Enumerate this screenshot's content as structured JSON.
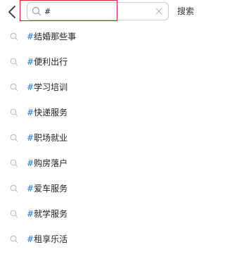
{
  "header": {
    "search": {
      "value": "#",
      "placeholder": ""
    },
    "submit_label": "搜索"
  },
  "suggestions": [
    {
      "hash": "#",
      "text": "结婚那些事"
    },
    {
      "hash": "#",
      "text": "便利出行"
    },
    {
      "hash": "#",
      "text": "学习培训"
    },
    {
      "hash": "#",
      "text": "快递服务"
    },
    {
      "hash": "#",
      "text": "职场就业"
    },
    {
      "hash": "#",
      "text": "购房落户"
    },
    {
      "hash": "#",
      "text": "爱车服务"
    },
    {
      "hash": "#",
      "text": "就学服务"
    },
    {
      "hash": "#",
      "text": "租享乐活"
    }
  ],
  "colors": {
    "accent_blue": "#1a73e8",
    "highlight_red": "#e0262b",
    "icon_gray": "#b5b5b5"
  },
  "icons": {
    "back": "chevron-left-icon",
    "search": "search-icon",
    "clear": "close-icon"
  }
}
